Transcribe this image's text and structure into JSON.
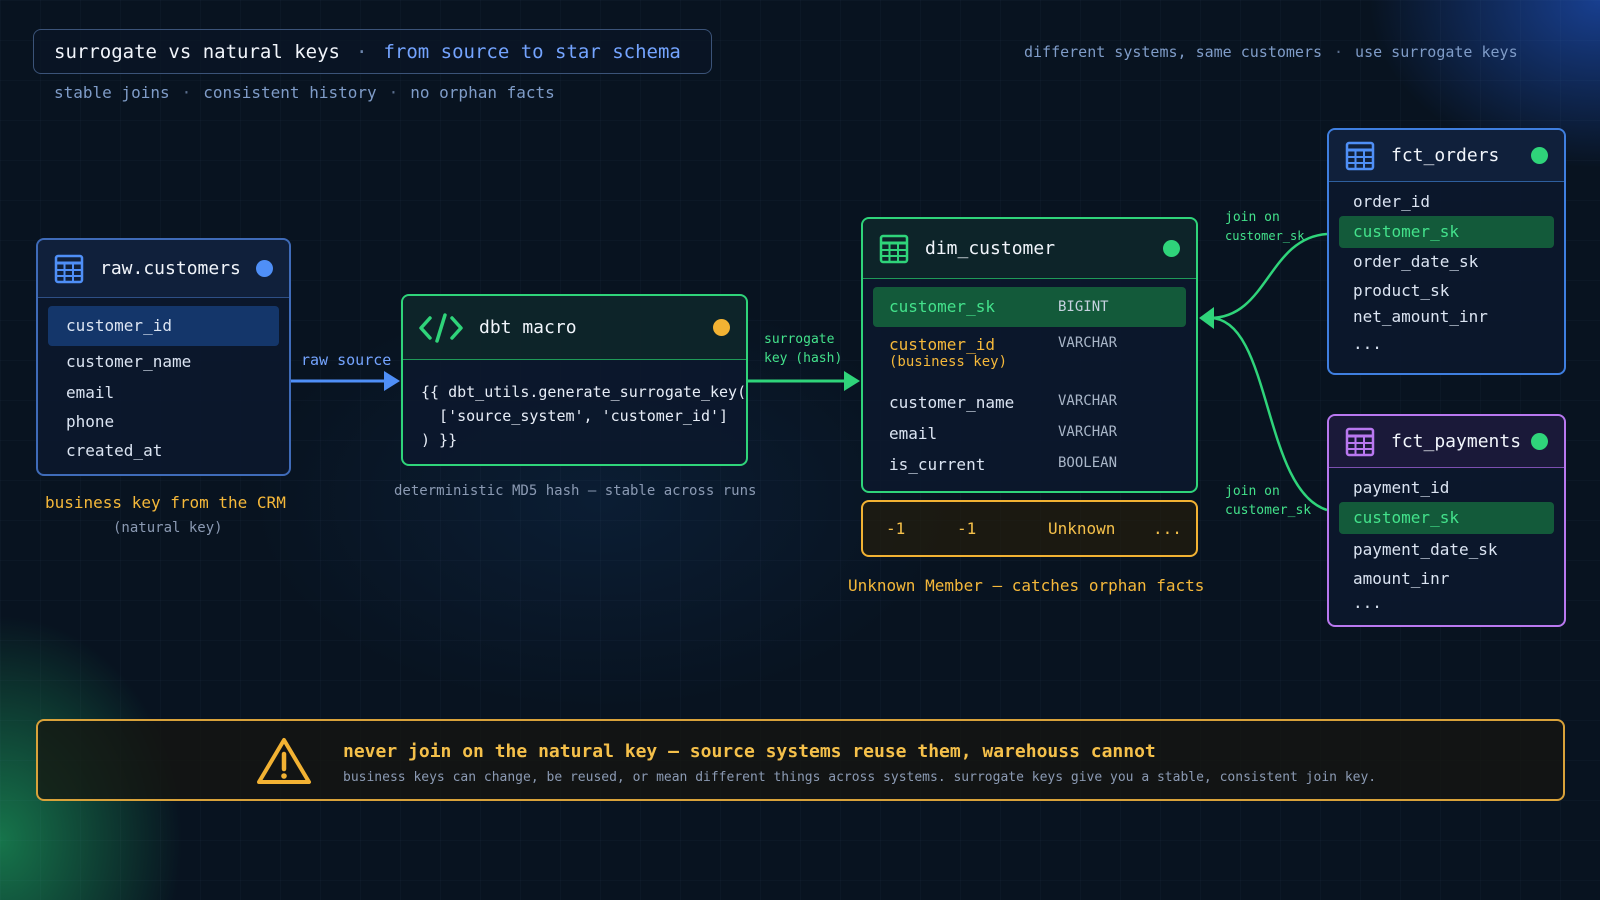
{
  "header": {
    "title_main": "surrogate vs natural keys",
    "title_sep": "·",
    "title_accent": "from source to star schema",
    "subline": [
      "stable joins",
      "consistent history",
      "no orphan facts"
    ],
    "subline_sep": "·",
    "top_right": [
      "different systems, same customers",
      "use surrogate keys"
    ]
  },
  "raw_table": {
    "title": "raw.customers",
    "icon": "table-icon",
    "status_color": "#4f8ff7",
    "columns": [
      "customer_id",
      "customer_name",
      "email",
      "phone",
      "created_at"
    ],
    "caption": "business key from the CRM",
    "caption_sub": "(natural key)"
  },
  "edge_raw_to_macro": {
    "label": "raw source"
  },
  "macro": {
    "title": "dbt macro",
    "icon": "code-icon",
    "status_color": "#f2b233",
    "code": [
      "{{ dbt_utils.generate_surrogate_key(",
      "  ['source_system', 'customer_id']",
      ") }}"
    ],
    "caption": "deterministic MD5 hash — stable across runs"
  },
  "edge_macro_to_dim": {
    "label_line1": "surrogate",
    "label_line2": "key (hash)"
  },
  "dim_table": {
    "title": "dim_customer",
    "icon": "table-icon",
    "status_color": "#2fd47a",
    "rows": [
      {
        "name": "customer_sk",
        "type": "BIGINT"
      },
      {
        "name": "customer_id",
        "note": "(business key)",
        "type": "VARCHAR"
      },
      {
        "name": "customer_name",
        "type": "VARCHAR"
      },
      {
        "name": "email",
        "type": "VARCHAR"
      },
      {
        "name": "is_current",
        "type": "BOOLEAN"
      }
    ]
  },
  "unknown_member": {
    "values": [
      "-1",
      "-1",
      "Unknown",
      "..."
    ],
    "caption": "Unknown Member — catches orphan facts"
  },
  "edge_orders": {
    "label_line1": "join on",
    "label_line2": "customer_sk"
  },
  "edge_payments": {
    "label_line1": "join on",
    "label_line2": "customer_sk"
  },
  "fct_orders": {
    "title": "fct_orders",
    "icon": "table-icon",
    "status_color": "#2fd47a",
    "columns": [
      "order_id",
      "customer_sk",
      "order_date_sk",
      "product_sk",
      "net_amount_inr",
      "..."
    ]
  },
  "fct_payments": {
    "title": "fct_payments",
    "icon": "table-icon",
    "status_color": "#2fd47a",
    "columns": [
      "payment_id",
      "customer_sk",
      "payment_date_sk",
      "amount_inr",
      "..."
    ]
  },
  "warning": {
    "icon": "warning-icon",
    "headline": "never join on the natural key  —  source systems reuse them, warehouss cannot",
    "detail": "business keys can change, be reused, or mean different things across systems.  surrogate keys give you a stable, consistent join key."
  },
  "colors": {
    "blue": "#4f8ff7",
    "green": "#2fd47a",
    "amber": "#f2b233",
    "purple": "#b978f0"
  }
}
